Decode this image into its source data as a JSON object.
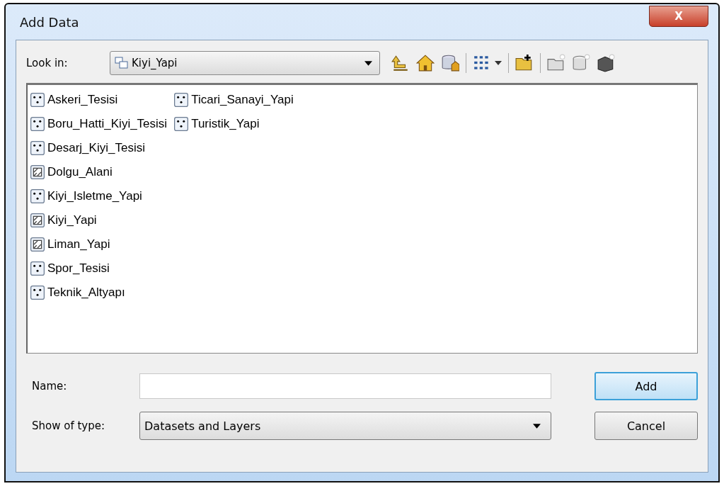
{
  "window": {
    "title": "Add Data",
    "close_glyph": "X"
  },
  "look_in": {
    "label": "Look in:",
    "value": "Kiyi_Yapi"
  },
  "items": [
    {
      "name": "Askeri_Tesisi",
      "kind": "point"
    },
    {
      "name": "Boru_Hatti_Kiyi_Tesisi",
      "kind": "point"
    },
    {
      "name": "Desarj_Kiyi_Tesisi",
      "kind": "point"
    },
    {
      "name": "Dolgu_Alani",
      "kind": "polygon"
    },
    {
      "name": "Kiyi_Isletme_Yapi",
      "kind": "point"
    },
    {
      "name": "Kiyi_Yapi",
      "kind": "polygon"
    },
    {
      "name": "Liman_Yapi",
      "kind": "polygon"
    },
    {
      "name": "Spor_Tesisi",
      "kind": "point"
    },
    {
      "name": "Teknik_Altyapı",
      "kind": "point"
    },
    {
      "name": "Ticari_Sanayi_Yapi",
      "kind": "point"
    },
    {
      "name": "Turistik_Yapi",
      "kind": "point"
    }
  ],
  "name_field": {
    "label": "Name:"
  },
  "type_field": {
    "label": "Show of type:",
    "value": "Datasets and Layers"
  },
  "buttons": [
    "Add",
    "Cancel"
  ]
}
